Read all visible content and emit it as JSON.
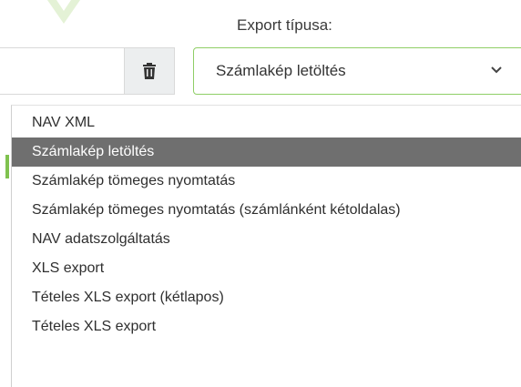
{
  "header": {
    "export_type_label": "Export típusa:"
  },
  "filter": {
    "text_value": "",
    "clear_icon": "trash-icon"
  },
  "export_select": {
    "selected": "Számlakép letöltés",
    "chevron_icon": "chevron-down-icon",
    "accent_color": "#8fce66"
  },
  "dropdown": {
    "selected_index": 1,
    "selected_bg": "#6f6f6f",
    "options": [
      "NAV XML",
      "Számlakép letöltés",
      "Számlakép tömeges nyomtatás",
      "Számlakép tömeges nyomtatás (számlánként kétoldalas)",
      "NAV adatszolgáltatás",
      "XLS export",
      "Tételes XLS export (kétlapos)",
      "Tételes XLS export"
    ]
  }
}
